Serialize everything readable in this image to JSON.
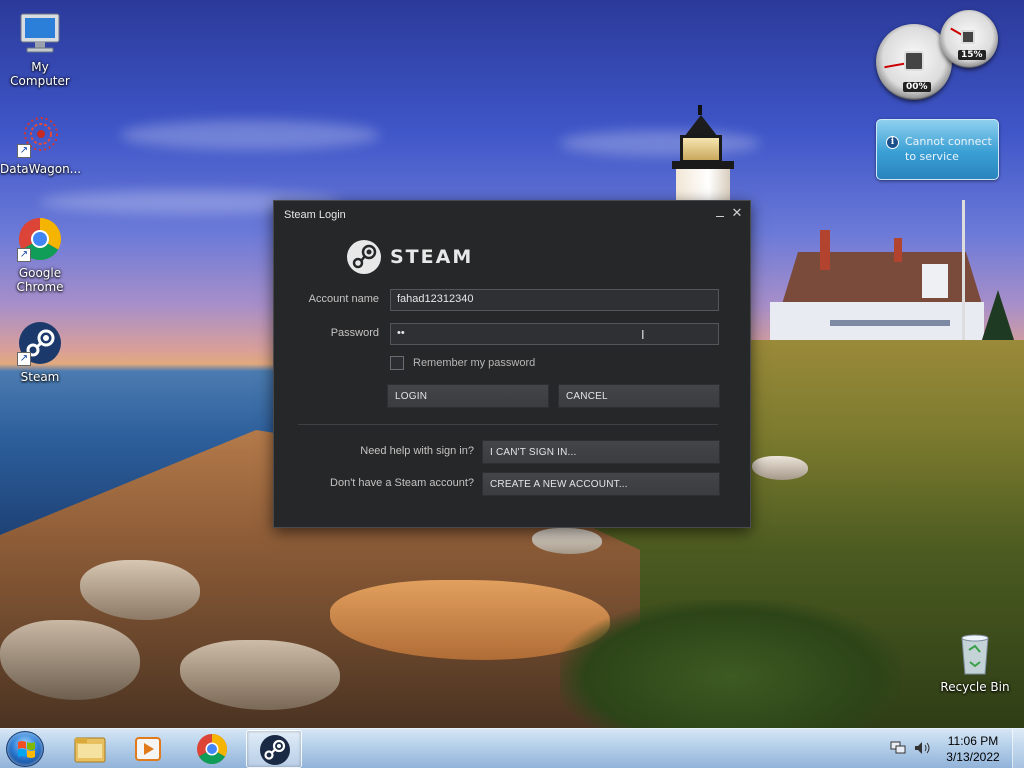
{
  "desktop": {
    "icons": [
      {
        "label": "My Computer"
      },
      {
        "label": "DataWagon..."
      },
      {
        "label": "Google Chrome"
      },
      {
        "label": "Steam"
      },
      {
        "label": "Recycle Bin"
      }
    ]
  },
  "gadget": {
    "cpu_percent_label": "00%",
    "mem_percent_label": "15%",
    "message": "Cannot connect to service"
  },
  "steam_dialog": {
    "title": "Steam Login",
    "brand": "STEAM",
    "account_name_label": "Account name",
    "account_name_value": "fahad12312340",
    "password_label": "Password",
    "password_value": "••",
    "remember_label": "Remember my password",
    "remember_checked": false,
    "login_button": "LOGIN",
    "cancel_button": "CANCEL",
    "help_label": "Need help with sign in?",
    "cant_sign_in_button": "I CAN'T SIGN IN...",
    "no_account_label": "Don't have a Steam account?",
    "create_account_button": "CREATE A NEW ACCOUNT..."
  },
  "taskbar": {
    "time": "11:06 PM",
    "date": "3/13/2022"
  },
  "colors": {
    "dialog_bg": "#262729",
    "button_bg": "#3a3c40",
    "gadget_blue": "#3a9fd4"
  }
}
